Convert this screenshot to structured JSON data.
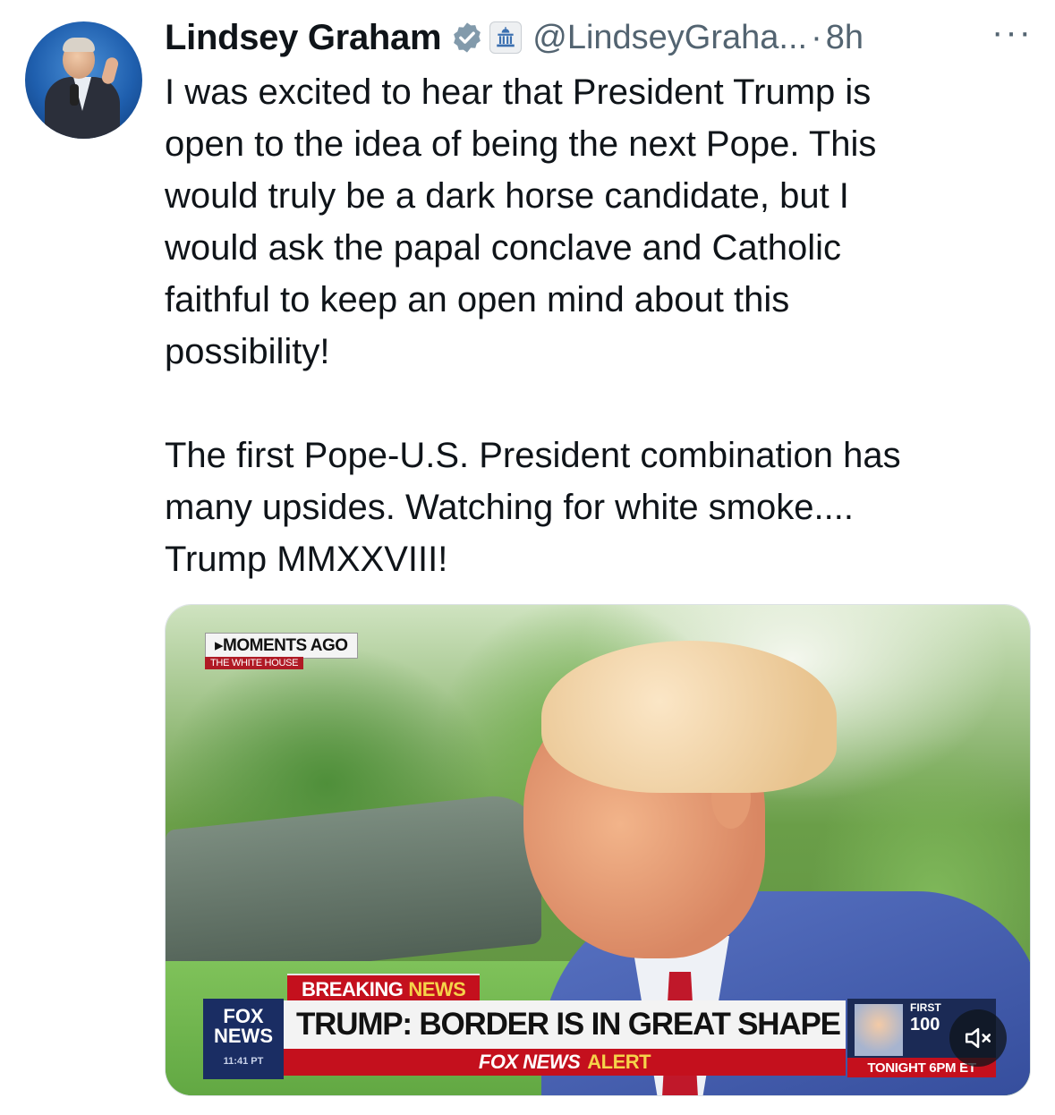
{
  "tweet": {
    "author_name": "Lindsey Graham",
    "handle": "@LindseyGraha...",
    "separator": "·",
    "time": "8h",
    "more_label": "···",
    "verified_icon": "verified-badge-icon",
    "affiliation_icon": "government-building-icon",
    "text": "I was excited to hear that President Trump is\nopen to the idea of being the next Pope. This\nwould truly be a dark horse candidate, but I\nwould ask the papal conclave and Catholic\nfaithful to keep an open mind about this\npossibility!\n\nThe first Pope-U.S. President combination has\nmany upsides. Watching for white smoke....\nTrump MMXXVIII!"
  },
  "video": {
    "moments_ago": "MOMENTS AGO",
    "location": "THE WHITE HOUSE",
    "breaking_part1": "BREAKING",
    "breaking_part2": "NEWS",
    "network_line1": "FOX",
    "network_line2": "NEWS",
    "clock": "11:41 PT",
    "headline": "TRUMP: BORDER IS IN GREAT SHAPE",
    "alert_part1": "FOX NEWS",
    "alert_part2": "ALERT",
    "promo_first": "FIRST",
    "promo_100": "100",
    "promo_tonight": "TONIGHT 6PM ET",
    "mute_icon": "speaker-muted-icon"
  },
  "colors": {
    "verified_blue": "#1d9bf0",
    "text_primary": "#0f1419",
    "text_secondary": "#536471",
    "fox_red": "#c4101d",
    "fox_navy": "#1a2d63"
  }
}
